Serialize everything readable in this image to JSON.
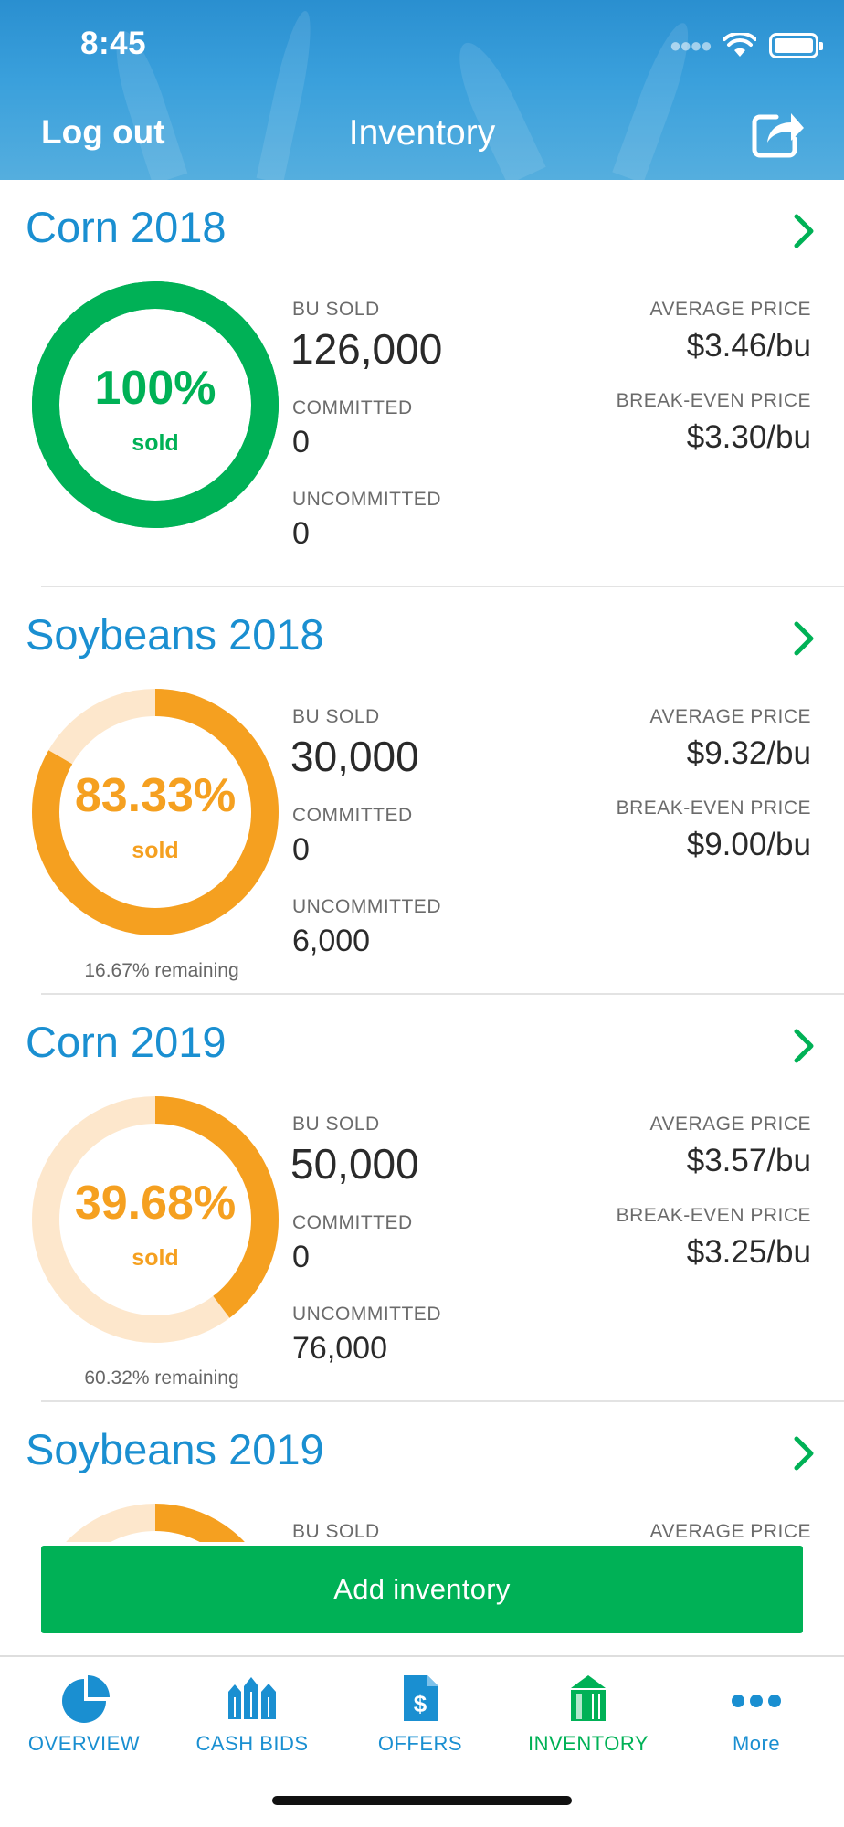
{
  "status_bar": {
    "time": "8:45"
  },
  "header": {
    "logout_label": "Log out",
    "title": "Inventory"
  },
  "crops": [
    {
      "title": "Corn 2018",
      "percent_label": "100%",
      "sold_word": "sold",
      "percent_sold": 100,
      "remaining_label": "",
      "color": "#00b156",
      "track_color": "#00b156",
      "bu_sold_label": "BU SOLD",
      "bu_sold": "126,000",
      "committed_label": "COMMITTED",
      "committed": "0",
      "uncommitted_label": "UNCOMMITTED",
      "uncommitted": "0",
      "avg_price_label": "AVERAGE PRICE",
      "avg_price": "$3.46/bu",
      "break_even_label": "BREAK-EVEN PRICE",
      "break_even": "$3.30/bu"
    },
    {
      "title": "Soybeans 2018",
      "percent_label": "83.33%",
      "sold_word": "sold",
      "percent_sold": 83.33,
      "remaining_label": "16.67% remaining",
      "color": "#f5a020",
      "track_color": "#fde7cc",
      "bu_sold_label": "BU SOLD",
      "bu_sold": "30,000",
      "committed_label": "COMMITTED",
      "committed": "0",
      "uncommitted_label": "UNCOMMITTED",
      "uncommitted": "6,000",
      "avg_price_label": "AVERAGE PRICE",
      "avg_price": "$9.32/bu",
      "break_even_label": "BREAK-EVEN PRICE",
      "break_even": "$9.00/bu"
    },
    {
      "title": "Corn 2019",
      "percent_label": "39.68%",
      "sold_word": "sold",
      "percent_sold": 39.68,
      "remaining_label": "60.32% remaining",
      "color": "#f5a020",
      "track_color": "#fde7cc",
      "bu_sold_label": "BU SOLD",
      "bu_sold": "50,000",
      "committed_label": "COMMITTED",
      "committed": "0",
      "uncommitted_label": "UNCOMMITTED",
      "uncommitted": "76,000",
      "avg_price_label": "AVERAGE PRICE",
      "avg_price": "$3.57/bu",
      "break_even_label": "BREAK-EVEN PRICE",
      "break_even": "$3.25/bu"
    },
    {
      "title": "Soybeans 2019",
      "percent_sold": 40,
      "color": "#f5a020",
      "track_color": "#fde7cc",
      "bu_sold_label": "BU SOLD",
      "avg_price_label": "AVERAGE PRICE"
    }
  ],
  "add_inventory_label": "Add inventory",
  "tabs": [
    {
      "label": "OVERVIEW",
      "icon": "pie-chart-icon"
    },
    {
      "label": "CASH BIDS",
      "icon": "grain-bins-icon"
    },
    {
      "label": "OFFERS",
      "icon": "dollar-document-icon"
    },
    {
      "label": "INVENTORY",
      "icon": "silo-icon",
      "active": true
    },
    {
      "label": "More",
      "icon": "more-dots-icon"
    }
  ],
  "colors": {
    "header_blue": "#2a8fd0",
    "title_blue": "#1a8fd1",
    "green": "#00b156",
    "orange": "#f5a020",
    "orange_track": "#fde7cc"
  }
}
